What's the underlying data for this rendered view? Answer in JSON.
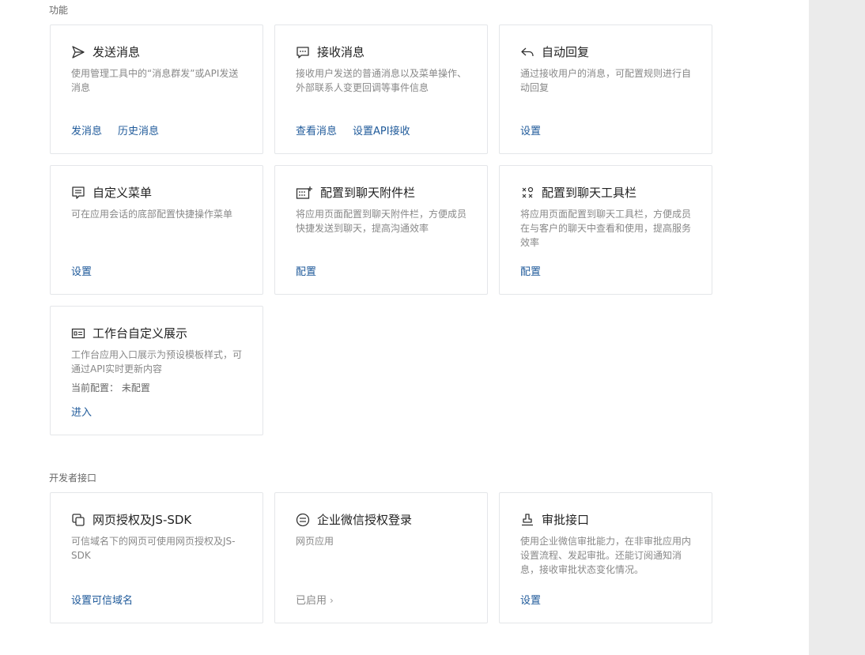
{
  "sections": {
    "features_title": "功能",
    "developer_title": "开发者接口"
  },
  "cards": {
    "send_message": {
      "icon": "send-icon",
      "title": "发送消息",
      "desc": "使用管理工具中的“消息群发”或API发送消息",
      "links": [
        "发消息",
        "历史消息"
      ]
    },
    "receive_message": {
      "icon": "chat-bubble-icon",
      "title": "接收消息",
      "desc": "接收用户发送的普通消息以及菜单操作、外部联系人变更回调等事件信息",
      "links": [
        "查看消息",
        "设置API接收"
      ]
    },
    "auto_reply": {
      "icon": "reply-icon",
      "title": "自动回复",
      "desc": "通过接收用户的消息，可配置规则进行自动回复",
      "links": [
        "设置"
      ]
    },
    "custom_menu": {
      "icon": "menu-icon",
      "title": "自定义菜单",
      "desc": "可在应用会话的底部配置快捷操作菜单",
      "links": [
        "设置"
      ]
    },
    "chat_attachment": {
      "icon": "attachment-bar-icon",
      "title": "配置到聊天附件栏",
      "desc": "将应用页面配置到聊天附件栏，方便成员快捷发送到聊天，提高沟通效率",
      "links": [
        "配置"
      ]
    },
    "chat_toolbar": {
      "icon": "toolbar-icon",
      "title": "配置到聊天工具栏",
      "desc": "将应用页面配置到聊天工具栏，方便成员在与客户的聊天中查看和使用，提高服务效率",
      "links": [
        "配置"
      ]
    },
    "workbench": {
      "icon": "id-card-icon",
      "title": "工作台自定义展示",
      "desc": "工作台应用入口展示为预设模板样式，可通过API实时更新内容",
      "meta": "当前配置：  未配置",
      "links": [
        "进入"
      ]
    },
    "web_auth": {
      "icon": "copy-icon",
      "title": "网页授权及JS-SDK",
      "desc": "可信域名下的网页可使用网页授权及JS-SDK",
      "links": [
        "设置可信域名"
      ]
    },
    "wecom_login": {
      "icon": "login-circle-icon",
      "title": "企业微信授权登录",
      "desc": "网页应用",
      "links": [
        "已启用"
      ]
    },
    "approval": {
      "icon": "stamp-icon",
      "title": "审批接口",
      "desc": "使用企业微信审批能力，在非审批应用内设置流程、发起审批。还能订阅通知消息，接收审批状态变化情况。",
      "links": [
        "设置"
      ]
    }
  }
}
